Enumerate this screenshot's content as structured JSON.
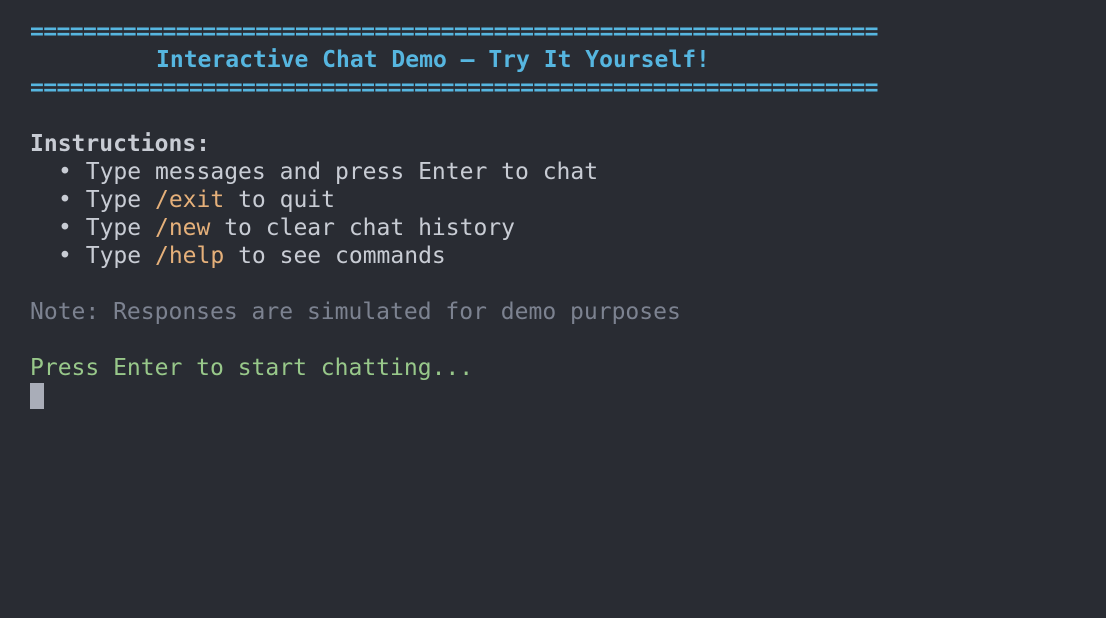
{
  "banner": {
    "rule": "================================================================",
    "title": "Interactive Chat Demo – Try It Yourself!"
  },
  "instructions": {
    "heading": "Instructions:",
    "items": [
      {
        "bullet": "•",
        "prefix": "Type ",
        "command": "",
        "suffix": "messages and press Enter to chat"
      },
      {
        "bullet": "•",
        "prefix": "Type ",
        "command": "/exit",
        "suffix": " to quit"
      },
      {
        "bullet": "•",
        "prefix": "Type ",
        "command": "/new",
        "suffix": " to clear chat history"
      },
      {
        "bullet": "•",
        "prefix": "Type ",
        "command": "/help",
        "suffix": " to see commands"
      }
    ]
  },
  "note": "Note: Responses are simulated for demo purposes",
  "prompt": "Press Enter to start chatting...",
  "colors": {
    "background": "#292c33",
    "accent": "#56b6e0",
    "command": "#e5b07a",
    "note": "#7c8290",
    "prompt": "#98c88a",
    "text": "#c8ccd4"
  }
}
